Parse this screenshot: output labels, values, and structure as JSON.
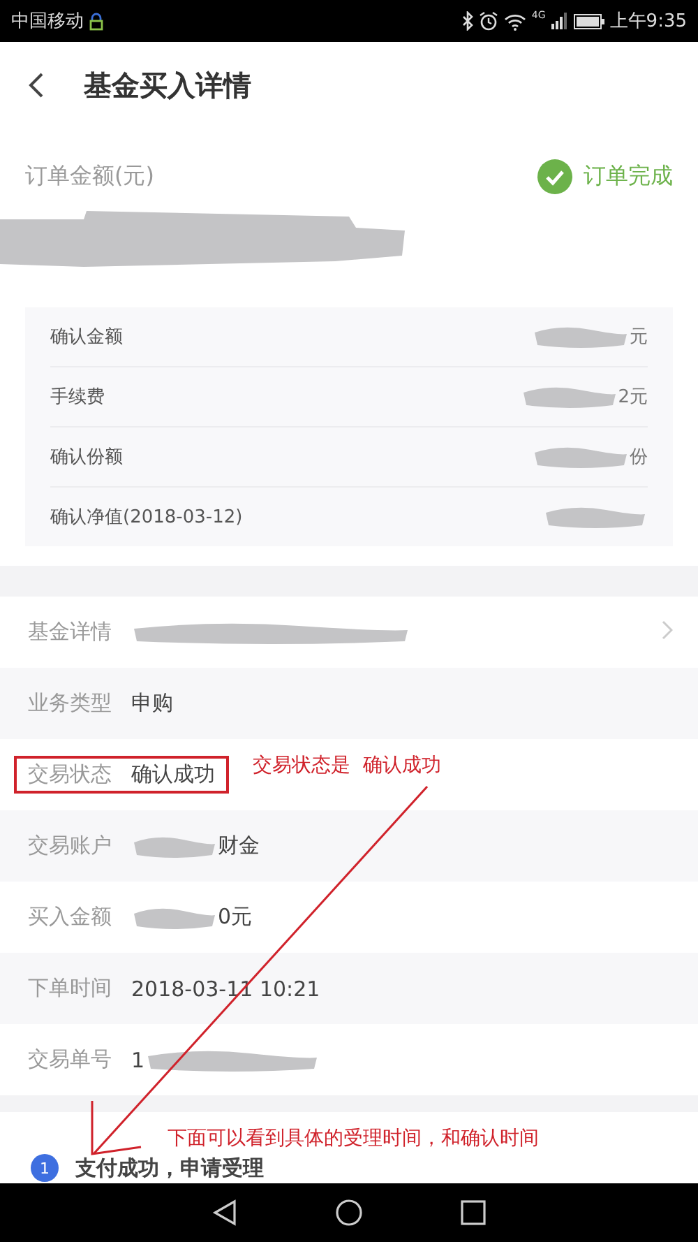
{
  "status_bar": {
    "carrier": "中国移动",
    "time": "上午9:35",
    "network": "4G"
  },
  "header": {
    "title": "基金买入详情"
  },
  "summary": {
    "label": "订单金额(元)",
    "status": "订单完成",
    "amount_redacted": true,
    "items": [
      {
        "label": "确认金额",
        "value": "元",
        "redacted": true
      },
      {
        "label": "手续费",
        "value": "2元",
        "redacted": true
      },
      {
        "label": "确认份额",
        "value": "份",
        "redacted": true
      },
      {
        "label": "确认净值(2018-03-12)",
        "redacted": true
      }
    ]
  },
  "details": [
    {
      "label": "基金详情",
      "redacted": true,
      "kind": "link",
      "highlighted": false
    },
    {
      "label": "业务类型",
      "value": "申购",
      "redacted": false,
      "kind": "plain",
      "highlighted": false
    },
    {
      "label": "交易状态",
      "value": "确认成功",
      "redacted": false,
      "kind": "plain",
      "highlighted": true
    },
    {
      "label": "交易账户",
      "value": "财金",
      "redacted": true,
      "kind": "plain",
      "highlighted": false
    },
    {
      "label": "买入金额",
      "value": "0元",
      "redacted": true,
      "kind": "plain",
      "highlighted": false
    },
    {
      "label": "下单时间",
      "value": "2018-03-11 10:21",
      "redacted": false,
      "kind": "plain",
      "highlighted": false
    },
    {
      "label": "交易单号",
      "value": "1",
      "redacted": true,
      "kind": "plain",
      "highlighted": false
    }
  ],
  "steps": [
    {
      "number": "1",
      "text": "支付成功，申请受理"
    }
  ],
  "annotations": {
    "callout": "交易状态是  确认成功",
    "note": "下面可以看到具体的受理时间，和确认时间"
  }
}
